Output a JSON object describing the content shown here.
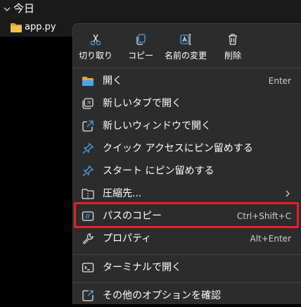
{
  "group": {
    "title": "今日"
  },
  "file": {
    "name": "app.py"
  },
  "colors": {
    "accent_folder": "#f0c24a",
    "icon_blue": "#4aa3e8",
    "highlight": "#e5202b",
    "menu_bg": "#2c2c2c"
  },
  "menu": {
    "actions": [
      {
        "label": "切り取り",
        "icon": "scissors-icon"
      },
      {
        "label": "コピー",
        "icon": "copy-icon"
      },
      {
        "label": "名前の変更",
        "icon": "rename-icon"
      },
      {
        "label": "削除",
        "icon": "trash-icon"
      }
    ],
    "items": [
      {
        "label": "開く",
        "shortcut": "Enter",
        "icon": "folder-open-icon"
      },
      {
        "label": "新しいタブで開く",
        "shortcut": "",
        "icon": "new-tab-icon"
      },
      {
        "label": "新しいウィンドウで開く",
        "shortcut": "",
        "icon": "new-window-icon"
      },
      {
        "label": "クイック アクセスにピン留めする",
        "shortcut": "",
        "icon": "pin-icon"
      },
      {
        "label": "スタート にピン留めする",
        "shortcut": "",
        "icon": "pin-icon"
      },
      {
        "label": "圧縮先...",
        "shortcut": "",
        "icon": "zip-folder-icon"
      },
      {
        "label": "パスのコピー",
        "shortcut": "Ctrl+Shift+C",
        "icon": "copy-path-icon"
      },
      {
        "label": "プロパティ",
        "shortcut": "Alt+Enter",
        "icon": "wrench-icon"
      },
      {
        "label": "ターミナルで開く",
        "shortcut": "",
        "icon": "terminal-icon"
      },
      {
        "label": "その他のオプションを確認",
        "shortcut": "",
        "icon": "more-options-icon"
      }
    ]
  }
}
